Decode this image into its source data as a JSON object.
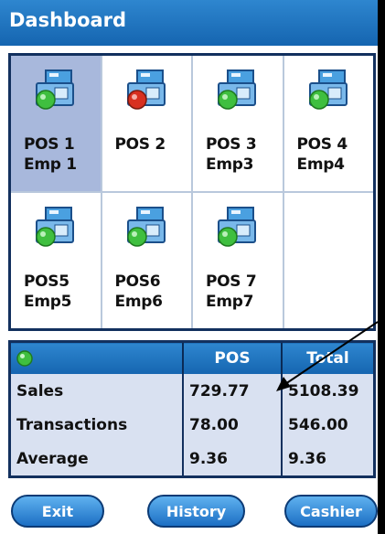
{
  "window": {
    "title": "Dashboard"
  },
  "tiles": [
    {
      "pos": "POS 1",
      "emp": "Emp 1",
      "status": "green",
      "selected": true
    },
    {
      "pos": "POS 2",
      "emp": "",
      "status": "red",
      "selected": false
    },
    {
      "pos": "POS 3",
      "emp": "Emp3",
      "status": "green",
      "selected": false
    },
    {
      "pos": "POS 4",
      "emp": "Emp4",
      "status": "green",
      "selected": false
    },
    {
      "pos": "POS5",
      "emp": "Emp5",
      "status": "green",
      "selected": false
    },
    {
      "pos": "POS6",
      "emp": "Emp6",
      "status": "green",
      "selected": false
    },
    {
      "pos": "POS 7",
      "emp": "Emp7",
      "status": "green",
      "selected": false
    }
  ],
  "stats": {
    "headers": {
      "pos": "POS",
      "total": "Total"
    },
    "rows": [
      {
        "label": "Sales",
        "pos": "729.77",
        "total": "5108.39"
      },
      {
        "label": "Transactions",
        "pos": "78.00",
        "total": "546.00"
      },
      {
        "label": "Average",
        "pos": "9.36",
        "total": "9.36"
      }
    ]
  },
  "buttons": {
    "exit": "Exit",
    "history": "History",
    "cashier": "Cashier"
  },
  "colors": {
    "title_bar": "#1f74c0",
    "online": "#3fbf3f",
    "offline": "#d83020",
    "selected_tile": "#a8b8dc",
    "border": "#12305e"
  }
}
